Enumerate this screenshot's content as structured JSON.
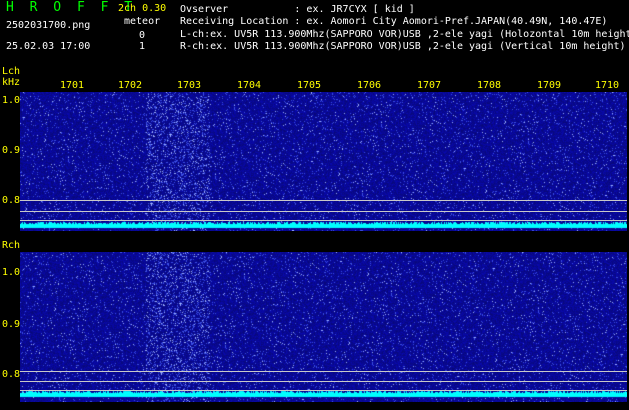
{
  "header": {
    "app_title": "H R O F F T",
    "version": "2ch 0.30",
    "filename": "2502031700.png",
    "meteor_label": "meteor",
    "meteor_l_count": "0",
    "meteor_r_count": "1",
    "timestamp": "25.02.03 17:00"
  },
  "info": {
    "observer": "Ovserver           : ex. JR7CYX [ kid ]",
    "location": "Receiving Location : ex. Aomori City Aomori-Pref.JAPAN(40.49N, 140.47E)",
    "lch": "L-ch:ex. UV5R 113.900Mhz(SAPPORO VOR)USB ,2-ele yagi (Holozontal 10m height)",
    "rch": "R-ch:ex. UV5R 113.900Mhz(SAPPORO VOR)USB ,2-ele yagi (Vertical 10m height)"
  },
  "lch_panel": {
    "label": "Lch",
    "unit": "kHz",
    "yticks": [
      "1.0",
      "0.9",
      "0.8"
    ]
  },
  "rch_panel": {
    "label": "Rch",
    "yticks": [
      "1.0",
      "0.9",
      "0.8"
    ]
  },
  "time_axis": {
    "ticks": [
      "1701",
      "1702",
      "1703",
      "1704",
      "1705",
      "1706",
      "1707",
      "1708",
      "1709",
      "1710"
    ]
  },
  "colors": {
    "green_title": "#00ff00",
    "yellow_text": "#ffff00",
    "white_text": "#ffffff",
    "spectrum_bg": "#0a0a8c",
    "baseline": "#00ffff"
  }
}
